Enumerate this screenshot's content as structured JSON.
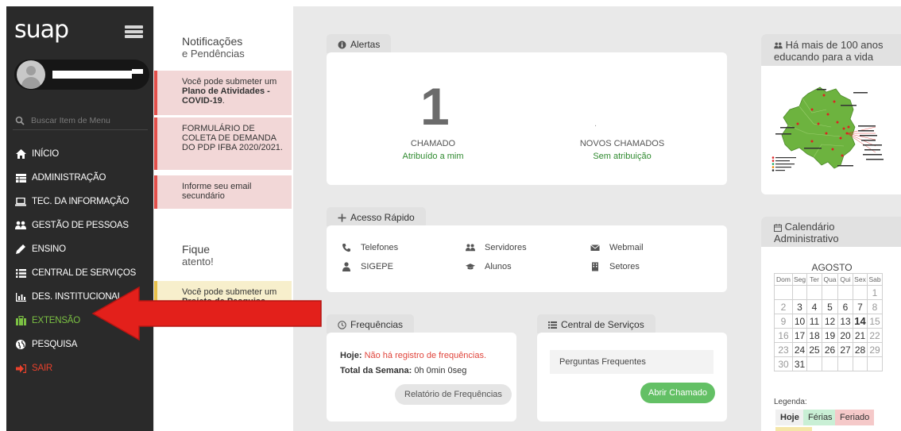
{
  "app": {
    "logo": "suap"
  },
  "sidebar": {
    "search_placeholder": "Buscar Item de Menu",
    "items": [
      {
        "label": "INÍCIO",
        "icon": "home-icon"
      },
      {
        "label": "ADMINISTRAÇÃO",
        "icon": "table-icon"
      },
      {
        "label": "TEC. DA INFORMAÇÃO",
        "icon": "laptop-icon"
      },
      {
        "label": "GESTÃO DE PESSOAS",
        "icon": "users-icon"
      },
      {
        "label": "ENSINO",
        "icon": "pencil-icon"
      },
      {
        "label": "CENTRAL DE SERVIÇOS",
        "icon": "list-icon"
      },
      {
        "label": "DES. INSTITUCIONAL",
        "icon": "bar-chart-icon"
      },
      {
        "label": "EXTENSÃO",
        "icon": "briefcase-icon"
      },
      {
        "label": "PESQUISA",
        "icon": "globe-icon"
      },
      {
        "label": "SAIR",
        "icon": "sign-out-icon"
      }
    ]
  },
  "notifications": {
    "title": "Notificações",
    "subtitle": "e Pendências",
    "items": [
      {
        "pre": "Você pode submeter um ",
        "bold": "Plano de Atividades - COVID-19",
        "post": "."
      },
      {
        "text": "FORMULÁRIO DE COLETA DE DEMANDA DO PDP IFBA 2020/2021."
      },
      {
        "text": "Informe seu email secundário"
      }
    ]
  },
  "attention": {
    "title": "Fique",
    "subtitle": "atento!",
    "items": [
      {
        "pre": "Você pode submeter um ",
        "bold": "Projeto de Pesquisa"
      }
    ]
  },
  "alertas": {
    "tab": "Alertas",
    "chamado_count": "1",
    "chamado_label": "CHAMADO",
    "chamado_link": "Atribuído a mim",
    "novos_count": ".",
    "novos_label": "NOVOS CHAMADOS",
    "novos_link": "Sem atribuição"
  },
  "acesso_rapido": {
    "tab": "Acesso Rápido",
    "items": [
      {
        "label": "Telefones",
        "icon": "phone-icon"
      },
      {
        "label": "Servidores",
        "icon": "users-icon"
      },
      {
        "label": "Webmail",
        "icon": "envelope-icon"
      },
      {
        "label": "SIGEPE",
        "icon": "user-icon"
      },
      {
        "label": "Alunos",
        "icon": "graduation-cap-icon"
      },
      {
        "label": "Setores",
        "icon": "building-icon"
      }
    ]
  },
  "frequencias": {
    "tab": "Frequências",
    "hoje_label": "Hoje:",
    "hoje_value": "Não há registro de frequências.",
    "semana_label": "Total da Semana:",
    "semana_value": "0h 0min 0seg",
    "button": "Relatório de Frequências"
  },
  "central_servicos": {
    "tab": "Central de Serviços",
    "faq": "Perguntas Frequentes",
    "button": "Abrir Chamado"
  },
  "history": {
    "title": "Há mais de 100 anos educando para a vida"
  },
  "calendar": {
    "title": "Calendário Administrativo",
    "month": "AGOSTO",
    "weekdays": [
      "Dom",
      "Seg",
      "Ter",
      "Qua",
      "Qui",
      "Sex",
      "Sab"
    ],
    "weeks": [
      [
        "",
        "",
        "",
        "",
        "",
        "",
        "1"
      ],
      [
        "2",
        "3",
        "4",
        "5",
        "6",
        "7",
        "8"
      ],
      [
        "9",
        "10",
        "11",
        "12",
        "13",
        "14",
        "15"
      ],
      [
        "16",
        "17",
        "18",
        "19",
        "20",
        "21",
        "22"
      ],
      [
        "23",
        "24",
        "25",
        "26",
        "27",
        "28",
        "29"
      ],
      [
        "30",
        "31",
        "",
        "",
        "",
        "",
        ""
      ]
    ],
    "today": "14",
    "legend_title": "Legenda:",
    "legend": [
      {
        "label": "Hoje",
        "color": "#f0f0f0"
      },
      {
        "label": "Férias",
        "color": "#c9efd5"
      },
      {
        "label": "Feriado",
        "color": "#f5c9c9"
      }
    ]
  },
  "colors": {
    "sidebar_bg": "#2a2a2a",
    "accent_green": "#63c065",
    "alert_red": "#e2504b",
    "arrow_red": "#e3201b"
  }
}
